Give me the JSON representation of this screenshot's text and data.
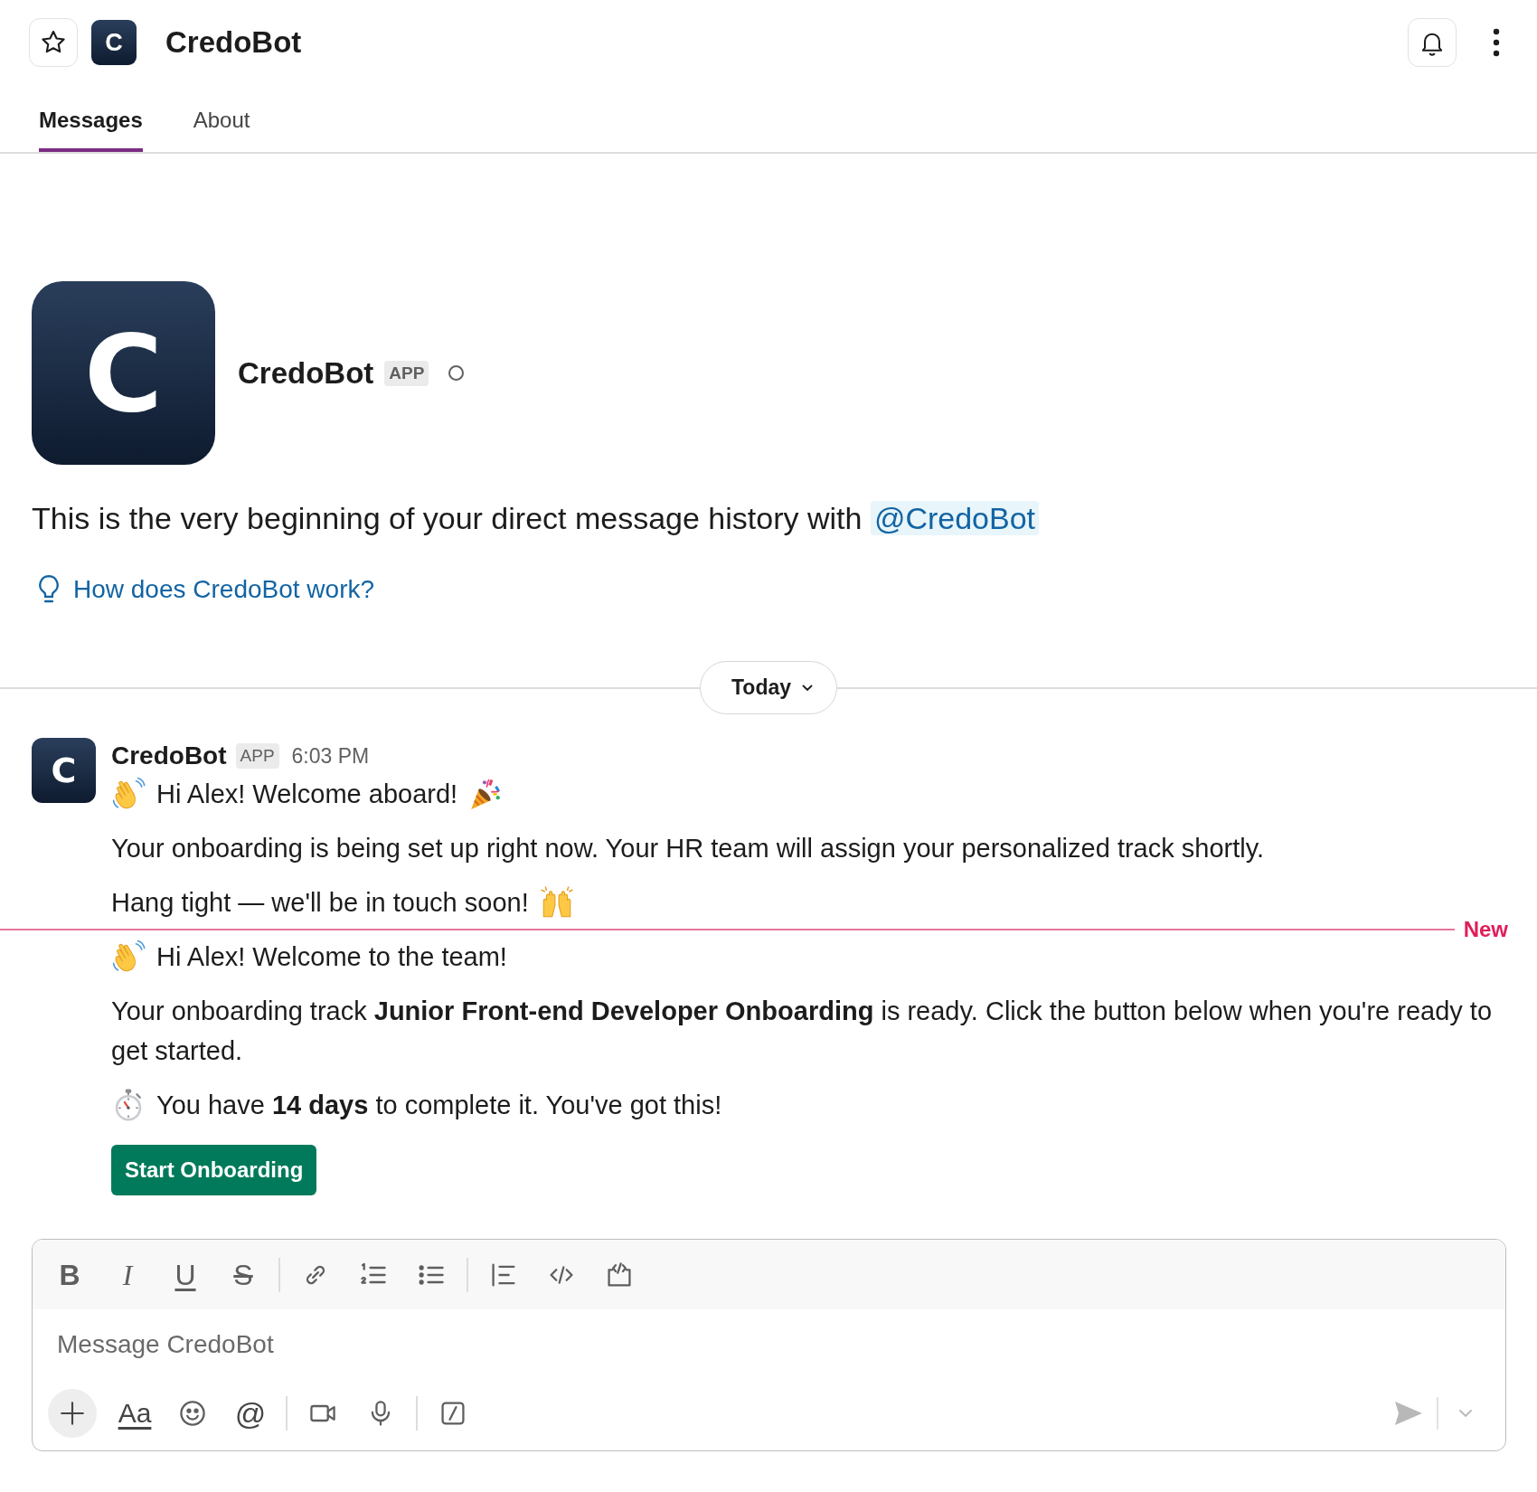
{
  "header": {
    "avatar_letter": "C",
    "title": "CredoBot",
    "starred": false
  },
  "tabs": [
    {
      "label": "Messages",
      "selected": true
    },
    {
      "label": "About",
      "selected": false
    }
  ],
  "profile": {
    "avatar_letter": "C",
    "name": "CredoBot",
    "badge": "APP",
    "online": false,
    "intro": "This is the very beginning of your direct message history with",
    "mention": "@CredoBot",
    "help_link": "How does CredoBot work?"
  },
  "date_divider": {
    "label": "Today"
  },
  "messages": [
    {
      "avatar_letter": "C",
      "sender": "CredoBot",
      "badge": "APP",
      "time": "6:03 PM",
      "lines": [
        {
          "kind": "welcome",
          "text": "Hi Alex! Welcome aboard!"
        },
        {
          "kind": "paragraph",
          "text": "Your onboarding is being set up right now. Your HR team will assign your personalized track shortly."
        },
        {
          "kind": "signoff",
          "text": "Hang tight — we'll be in touch soon!"
        }
      ]
    },
    {
      "new_label": "New",
      "lines": [
        {
          "kind": "greeting",
          "text": "Hi Alex! Welcome to the team!"
        },
        {
          "kind": "paragraph",
          "text": "Your onboarding track **Junior Front-end Developer Onboarding** is ready. Click the button below when you're ready to get started."
        },
        {
          "kind": "deadline",
          "text": "You have **14 days** to complete it. You've got this!"
        }
      ],
      "action": {
        "label": "Start Onboarding"
      }
    }
  ],
  "composer": {
    "format_groups": [
      [
        {
          "kind": "bold",
          "label": "B"
        },
        {
          "kind": "italic",
          "label": "I"
        },
        {
          "kind": "underline",
          "label": "U"
        },
        {
          "kind": "strike",
          "label": "S"
        }
      ],
      [
        {
          "kind": "link"
        },
        {
          "kind": "ordered-list"
        },
        {
          "kind": "bulleted-list"
        }
      ],
      [
        {
          "kind": "quote"
        },
        {
          "kind": "code"
        },
        {
          "kind": "code-block"
        }
      ]
    ],
    "placeholder": "Message CredoBot",
    "action_groups": [
      [
        {
          "kind": "add"
        },
        {
          "kind": "text-format",
          "label": "Aa"
        },
        {
          "kind": "emoji"
        },
        {
          "kind": "mention",
          "label": "@"
        }
      ],
      [
        {
          "kind": "video"
        },
        {
          "kind": "audio"
        }
      ],
      [
        {
          "kind": "shortcuts"
        }
      ]
    ],
    "send": {
      "disabled": true
    }
  }
}
